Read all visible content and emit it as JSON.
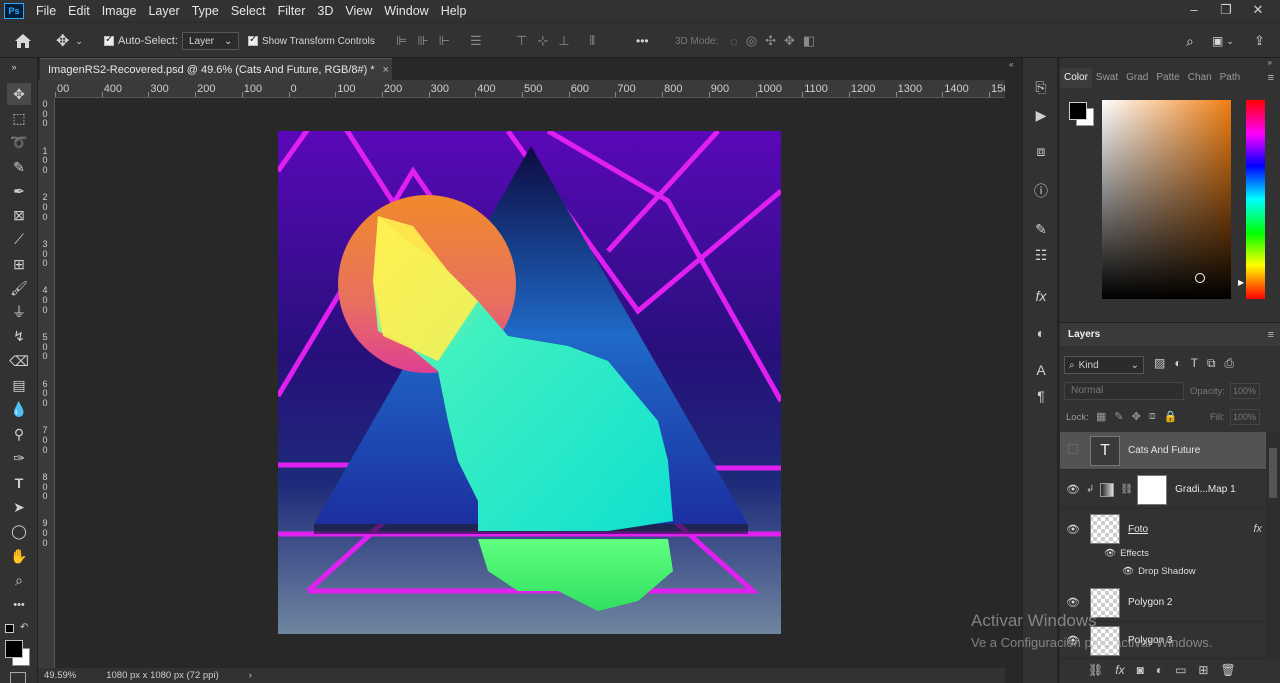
{
  "menu": [
    "File",
    "Edit",
    "Image",
    "Layer",
    "Type",
    "Select",
    "Filter",
    "3D",
    "View",
    "Window",
    "Help"
  ],
  "app_logo": "Ps",
  "options_bar": {
    "auto_select_label": "Auto-Select:",
    "auto_select_target": "Layer",
    "show_transform_label": "Show Transform Controls",
    "mode_3d_label": "3D Mode:",
    "more_label": "•••"
  },
  "document_tab": {
    "title": "ImagenRS2-Recovered.psd @ 49.6% (Cats  And Future, RGB/8#) *",
    "close": "×"
  },
  "ruler_top_labels": [
    "00",
    "400",
    "300",
    "200",
    "100",
    "0",
    "100",
    "200",
    "300",
    "400",
    "500",
    "600",
    "700",
    "800",
    "900",
    "1000",
    "1100",
    "1200",
    "1300",
    "1400",
    "1500"
  ],
  "ruler_left_labels": [
    "0",
    "0",
    "0",
    "1",
    "0",
    "0",
    "2",
    "0",
    "0",
    "3",
    "0",
    "0",
    "4",
    "0",
    "0",
    "5",
    "0",
    "0",
    "6",
    "0",
    "0",
    "7",
    "0",
    "0",
    "8",
    "0",
    "0",
    "9",
    "0",
    "0"
  ],
  "status_bar": {
    "zoom": "49.59%",
    "doc_size": "1080 px x 1080 px (72 ppi)",
    "arrow": "›"
  },
  "color_panel": {
    "tabs": [
      "Color",
      "Swat",
      "Grad",
      "Patte",
      "Chan",
      "Path"
    ],
    "foreground": "#000000",
    "background": "#ffffff",
    "hue_color": "#f07e12"
  },
  "layers_panel": {
    "title": "Layers",
    "filter_label": "Kind",
    "blend_mode": "Normal",
    "opacity_label": "Opacity:",
    "opacity_value": "100%",
    "lock_label": "Lock:",
    "fill_label": "Fill:",
    "fill_value": "100%",
    "layers": [
      {
        "name": "Cats  And Future",
        "type": "text",
        "thumb": "T",
        "visible": false,
        "selected": true
      },
      {
        "name": "Gradi...Map 1",
        "type": "adjustment",
        "visible": true,
        "selected": false
      },
      {
        "name": "Foto",
        "type": "pixel",
        "visible": true,
        "selected": false,
        "fx": "fx"
      },
      {
        "name": "Polygon 2",
        "type": "shape",
        "visible": true,
        "selected": false
      },
      {
        "name": "Polygon 3",
        "type": "shape",
        "visible": true,
        "selected": false
      }
    ],
    "effects_label": "Effects",
    "drop_shadow_label": "Drop Shadow"
  },
  "watermark": {
    "line1": "Activar Windows",
    "line2": "Ve a Configuración para activar Windows."
  }
}
